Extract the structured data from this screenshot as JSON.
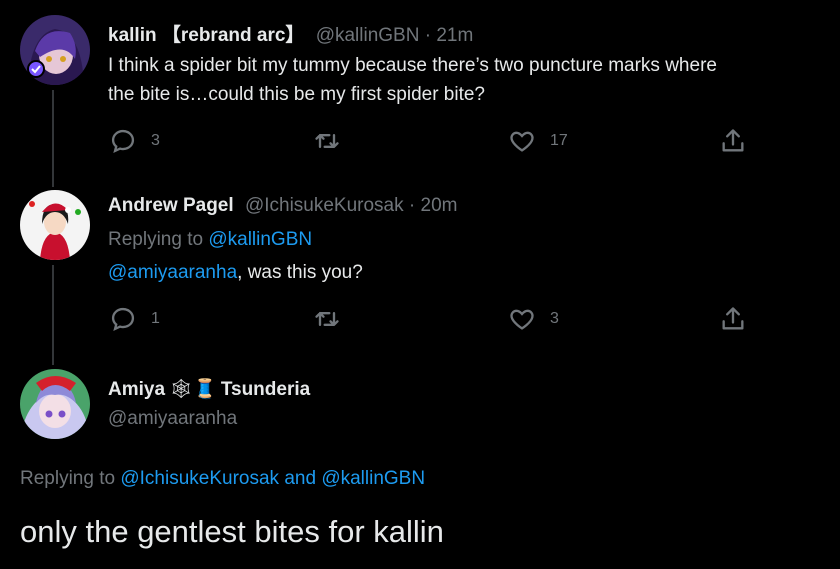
{
  "tweets": [
    {
      "name": "kallin 【rebrand arc】",
      "handle": "@kallinGBN",
      "time": "21m",
      "text_line1": "I think a spider bit my tummy because there’s two puncture marks where",
      "text_line2": "the bite is…could this be my first spider bite?",
      "replies": "3",
      "retweets": "",
      "likes": "17"
    },
    {
      "name": "Andrew Pagel",
      "handle": "@IchisukeKurosak",
      "time": "20m",
      "replying_prefix": "Replying to ",
      "replying_to": "@kallinGBN",
      "mention": "@amiyaaranha",
      "text_rest": ", was this you?",
      "replies": "1",
      "retweets": "",
      "likes": "3"
    }
  ],
  "main_tweet": {
    "name": "Amiya",
    "name_emoji": "🕸🧵",
    "name_suffix": "Tsunderia",
    "handle": "@amiyaaranha",
    "replying_prefix": "Replying to ",
    "replying_user1": "@IchisukeKurosak",
    "replying_and": " and ",
    "replying_user2": "@kallinGBN",
    "text": "only the gentlest bites for kallin"
  },
  "separator": "·",
  "colors": {
    "background": "#000000",
    "text": "#e7e9ea",
    "muted": "#71767b",
    "link": "#1d9bf0",
    "thread_line": "#333639"
  },
  "icons": [
    "reply-icon",
    "retweet-icon",
    "like-icon",
    "share-icon",
    "verified-badge-icon"
  ]
}
